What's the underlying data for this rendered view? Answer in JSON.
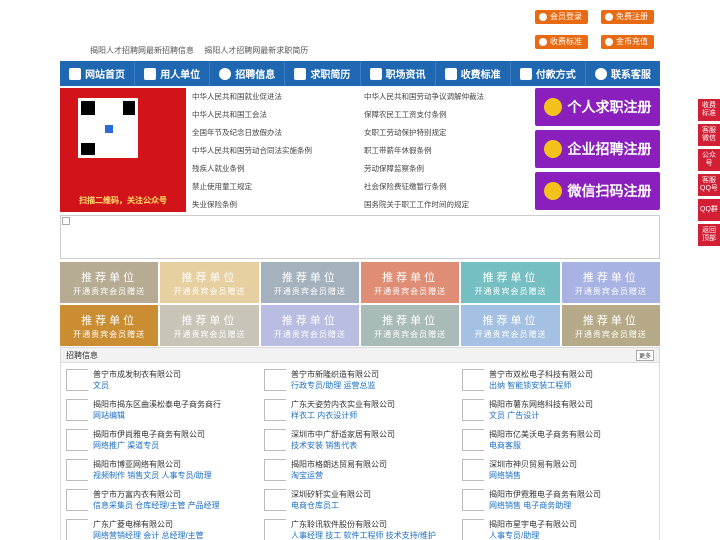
{
  "header": {
    "links": [
      "揭阳人才招聘网最新招聘信息",
      "揭阳人才招聘网最新求职简历"
    ],
    "buttons": {
      "member_login": "会员登录",
      "free_register": "免费注册",
      "fee_standard": "收费标准",
      "gold_recharge": "金币充值"
    }
  },
  "nav": {
    "items": [
      "网站首页",
      "用人单位",
      "招聘信息",
      "求职简历",
      "职场资讯",
      "收费标准",
      "付款方式",
      "联系客服"
    ]
  },
  "qr": {
    "caption": "扫描二维码，关注公众号"
  },
  "laws": {
    "left": [
      "中华人民共和国就业促进法",
      "中华人民共和国工会法",
      "全国年节及纪念日放假办法",
      "中华人民共和国劳动合同法实施条例",
      "残疾人就业条例",
      "禁止使用童工规定",
      "失业保险条例"
    ],
    "right": [
      "中华人民共和国劳动争议调解仲裁法",
      "保障农民工工资支付条例",
      "女职工劳动保护特别规定",
      "职工带薪年休假条例",
      "劳动保障监察条例",
      "社会保险费征缴暂行条例",
      "国务院关于职工工作时间的规定"
    ]
  },
  "register": {
    "personal": "个人求职注册",
    "company": "企业招聘注册",
    "wechat": "微信扫码注册"
  },
  "recommend": {
    "title": "推荐单位",
    "subtitle": "开通贵宾会员赠送",
    "colors": [
      "#b6ab93",
      "#e6cfa0",
      "#a6b1be",
      "#df8e75",
      "#75bfc2",
      "#a8b3e3",
      "#ca8d32",
      "#c8c4b7",
      "#b8bde1",
      "#a9bbb8",
      "#a4c0e2",
      "#b6a987"
    ]
  },
  "jobs": {
    "title": "招聘信息",
    "more": "更多",
    "items": [
      {
        "company": "普宁市成发制衣有限公司",
        "positions": "文员"
      },
      {
        "company": "普宁市新隆织造有限公司",
        "positions": "行政专员/助理  运营总监"
      },
      {
        "company": "普宁市双松电子科技有限公司",
        "positions": "出纳  智能锁安装工程师"
      },
      {
        "company": "揭阳市揭东区曲溪松泰电子商务商行",
        "positions": "网站编辑"
      },
      {
        "company": "广东天姿劳内衣实业有限公司",
        "positions": "样衣工  内衣设计师"
      },
      {
        "company": "揭阳市薯东网络科技有限公司",
        "positions": "文员  广告设计"
      },
      {
        "company": "揭阳市伊尚雅电子商务有限公司",
        "positions": "网络推广  渠道专员"
      },
      {
        "company": "深圳市中广舒适家居有限公司",
        "positions": "技术安装  销售代表"
      },
      {
        "company": "揭阳市亿美沃电子商务有限公司",
        "positions": "电商客服"
      },
      {
        "company": "揭阳市博亚网络有限公司",
        "positions": "视频制作  销售文员  人事专员/助理"
      },
      {
        "company": "揭阳市格朗达贸易有限公司",
        "positions": "淘宝运营"
      },
      {
        "company": "深圳市神贝贸易有限公司",
        "positions": "网络销售"
      },
      {
        "company": "普宁市万富内衣有限公司",
        "positions": "信息采集员  仓库经理/主管  产品经理"
      },
      {
        "company": "深圳矽轩实业有限公司",
        "positions": "电商仓库员工"
      },
      {
        "company": "揭阳市伊霓雅电子商务有限公司",
        "positions": "网络销售  电子商务助理"
      },
      {
        "company": "广东广菱电梯有限公司",
        "positions": "网络营销经理  会计  总经理/主管"
      },
      {
        "company": "广东聆讯软件股份有限公司",
        "positions": "人事经理  技工  软件工程师  技术支持/维护"
      },
      {
        "company": "揭阳市星宇电子有限公司",
        "positions": "人事专员/助理"
      }
    ]
  },
  "side": {
    "buttons": [
      "收费标准",
      "客服微信",
      "公众号",
      "客服QQ号",
      "QQ群",
      "返回顶部"
    ]
  }
}
